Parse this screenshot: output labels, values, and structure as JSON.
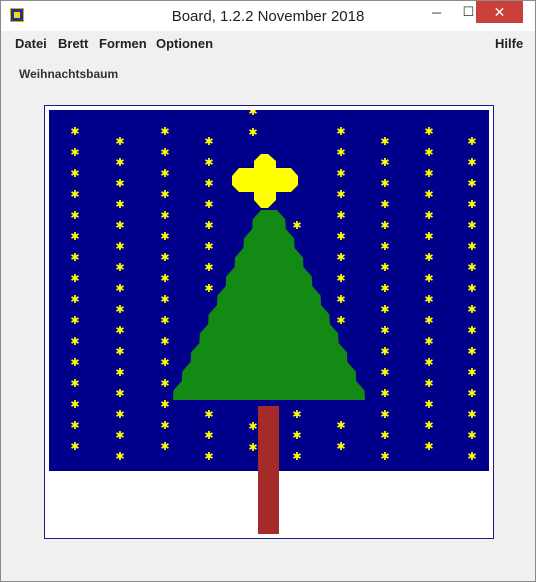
{
  "window": {
    "title": "Board, 1.2.2 November 2018"
  },
  "controls": {
    "minimize": "─",
    "maximize": "☐",
    "close": "✕"
  },
  "menu": {
    "datei": "Datei",
    "brett": "Brett",
    "formen": "Formen",
    "optionen": "Optionen",
    "hilfe": "Hilfe"
  },
  "board": {
    "heading": "Weihnachtsbaum",
    "colors": {
      "sky": "#00008b",
      "snow": "#ffffff",
      "tree": "#138a13",
      "trunk": "#a52a2a",
      "star": "#ffff00",
      "snowflake": "#ffff00"
    }
  }
}
